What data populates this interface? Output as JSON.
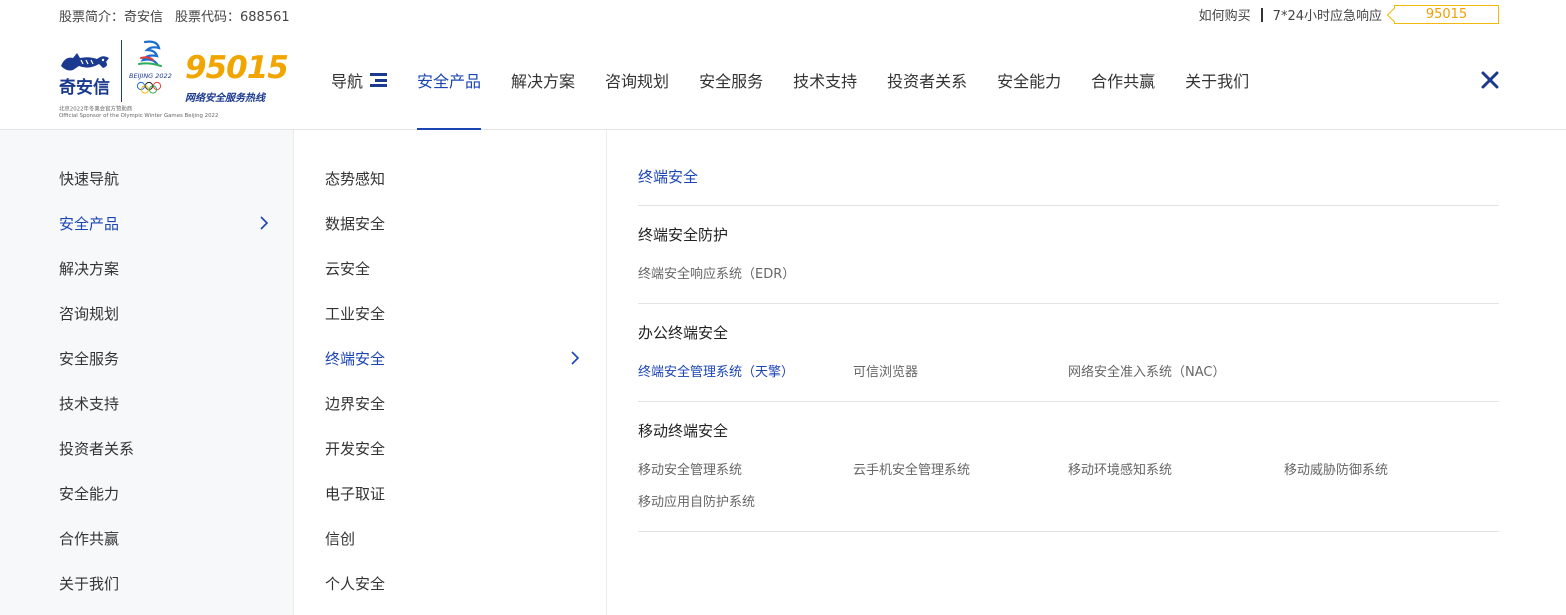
{
  "topbar": {
    "stock_intro": "股票简介：奇安信",
    "stock_code": "股票代码：688561",
    "buy_link": "如何购买",
    "support_link": "7*24小时应急响应",
    "hotline": "95015"
  },
  "logo": {
    "brand": "奇安信",
    "event": "BEIJING 2022",
    "hotline_number": "95015",
    "hotline_label": "网络安全服务热线",
    "sponsor_cn": "北京2022年冬奥会官方赞助商",
    "sponsor_en": "Official Sponsor of the Olympic Winter Games Beijing 2022"
  },
  "nav": {
    "items": [
      {
        "label": "导航"
      },
      {
        "label": "安全产品"
      },
      {
        "label": "解决方案"
      },
      {
        "label": "咨询规划"
      },
      {
        "label": "安全服务"
      },
      {
        "label": "技术支持"
      },
      {
        "label": "投资者关系"
      },
      {
        "label": "安全能力"
      },
      {
        "label": "合作共赢"
      },
      {
        "label": "关于我们"
      }
    ]
  },
  "menu_l1": [
    "快速导航",
    "安全产品",
    "解决方案",
    "咨询规划",
    "安全服务",
    "技术支持",
    "投资者关系",
    "安全能力",
    "合作共赢",
    "关于我们"
  ],
  "menu_l2": [
    "态势感知",
    "数据安全",
    "云安全",
    "工业安全",
    "终端安全",
    "边界安全",
    "开发安全",
    "电子取证",
    "信创",
    "个人安全"
  ],
  "detail": {
    "title": "终端安全",
    "groups": [
      {
        "title": "终端安全防护",
        "products": [
          "终端安全响应系统（EDR）"
        ]
      },
      {
        "title": "办公终端安全",
        "products": [
          "终端安全管理系统（天擎）",
          "可信浏览器",
          "网络安全准入系统（NAC）"
        ]
      },
      {
        "title": "移动终端安全",
        "products": [
          "移动安全管理系统",
          "云手机安全管理系统",
          "移动环境感知系统",
          "移动威胁防御系统",
          "移动应用自防护系统"
        ]
      }
    ]
  },
  "colors": {
    "accent": "#1b45b5",
    "brand_navy": "#1b3a8f",
    "hotline_gold": "#f0a500"
  }
}
